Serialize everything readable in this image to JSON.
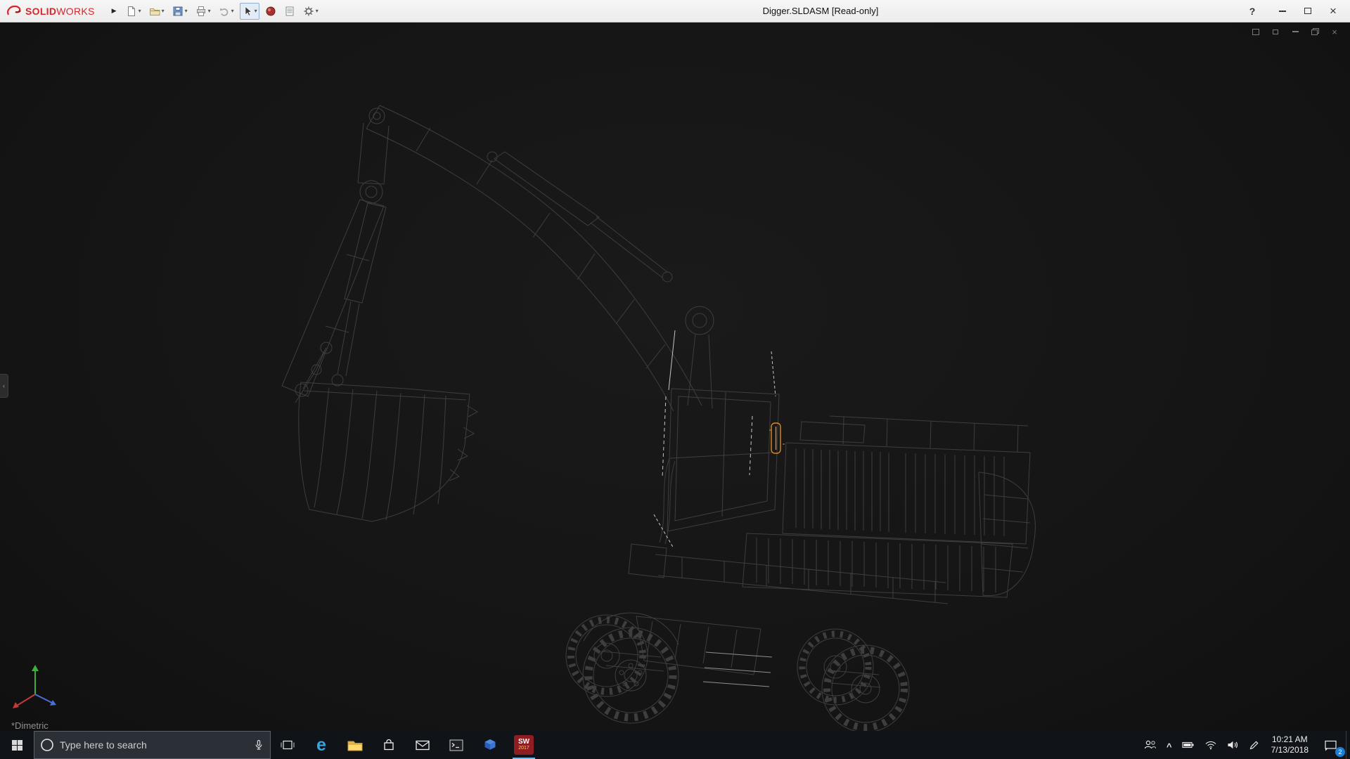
{
  "titlebar": {
    "brand_bold": "SOLID",
    "brand_light": "WORKS",
    "document_title": "Digger.SLDASM [Read-only]",
    "help_label": "?",
    "toolbar_icon_names": [
      "new-document-icon",
      "open-icon",
      "save-icon",
      "print-icon",
      "undo-icon",
      "select-cursor-icon",
      "appearance-sphere-icon",
      "design-table-icon",
      "options-gear-icon"
    ]
  },
  "glyphs": {
    "caret": "▾",
    "flyout": "▶",
    "close": "×",
    "chevron_up": "^",
    "edge_e": "e",
    "panel_collapse": "‹"
  },
  "viewport": {
    "orientation_label": "*Dimetric",
    "model_name": "excavator-wireframe",
    "selected_part_color": "#dd8a1f",
    "wireframe_color": "#3e3e3e",
    "background_color": "#151515"
  },
  "taskbar": {
    "search_placeholder": "Type here to search",
    "clock_time": "10:21 AM",
    "clock_date": "7/13/2018",
    "notification_badge": "2",
    "solidworks_label_top": "SW",
    "solidworks_label_year": "2017",
    "app_icon_names": [
      "start-icon",
      "search-ring-icon",
      "microphone-icon",
      "task-view-icon",
      "edge-icon",
      "file-explorer-icon",
      "store-icon",
      "mail-icon",
      "command-prompt-icon",
      "cad-cube-icon",
      "solidworks-icon"
    ],
    "tray_icon_names": [
      "people-icon",
      "chevron-up-icon",
      "battery-icon",
      "wifi-icon",
      "volume-icon",
      "pen-icon",
      "clock",
      "action-center-icon"
    ]
  },
  "colors": {
    "brand_red": "#d6252b",
    "badge_blue": "#1a7fd4",
    "selection_orange": "#dd8a1f",
    "titlebar_bg": "#f0f0f0",
    "taskbar_bg": "#101317"
  }
}
